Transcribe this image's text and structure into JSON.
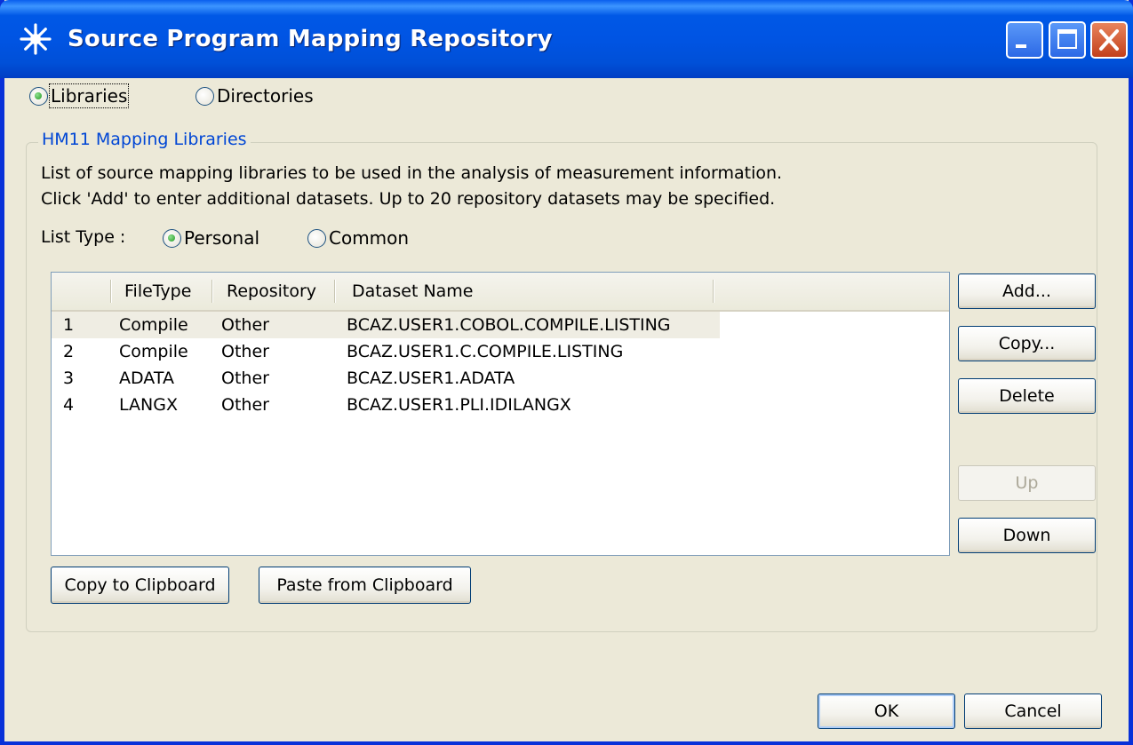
{
  "window": {
    "title": "Source Program Mapping Repository"
  },
  "mode": {
    "libraries_label": "Libraries",
    "directories_label": "Directories",
    "selected": "Libraries"
  },
  "group": {
    "legend": "HM11 Mapping Libraries",
    "description_line1": "List of source mapping libraries to be used in the analysis of measurement information.",
    "description_line2": "Click 'Add' to enter additional datasets. Up to 20 repository datasets may be specified."
  },
  "list_type": {
    "label": "List Type :",
    "personal_label": "Personal",
    "common_label": "Common",
    "selected": "Personal"
  },
  "table": {
    "columns": [
      "",
      "FileType",
      "Repository",
      "Dataset Name"
    ],
    "rows": [
      {
        "num": "1",
        "filetype": "Compile",
        "repository": "Other",
        "dataset": "BCAZ.USER1.COBOL.COMPILE.LISTING"
      },
      {
        "num": "2",
        "filetype": "Compile",
        "repository": "Other",
        "dataset": "BCAZ.USER1.C.COMPILE.LISTING"
      },
      {
        "num": "3",
        "filetype": "ADATA",
        "repository": "Other",
        "dataset": "BCAZ.USER1.ADATA"
      },
      {
        "num": "4",
        "filetype": "LANGX",
        "repository": "Other",
        "dataset": "BCAZ.USER1.PLI.IDILANGX"
      }
    ],
    "selected_row": 1
  },
  "side_buttons": {
    "add": "Add...",
    "copy": "Copy...",
    "delete": "Delete",
    "up": "Up",
    "down": "Down"
  },
  "clipboard": {
    "copy": "Copy to Clipboard",
    "paste": "Paste from Clipboard"
  },
  "dialog_buttons": {
    "ok": "OK",
    "cancel": "Cancel"
  },
  "colors": {
    "titlebar": "#0054e3",
    "frame": "#0831d9",
    "dialog_bg": "#ece9d8",
    "legend_text": "#0046d5"
  }
}
